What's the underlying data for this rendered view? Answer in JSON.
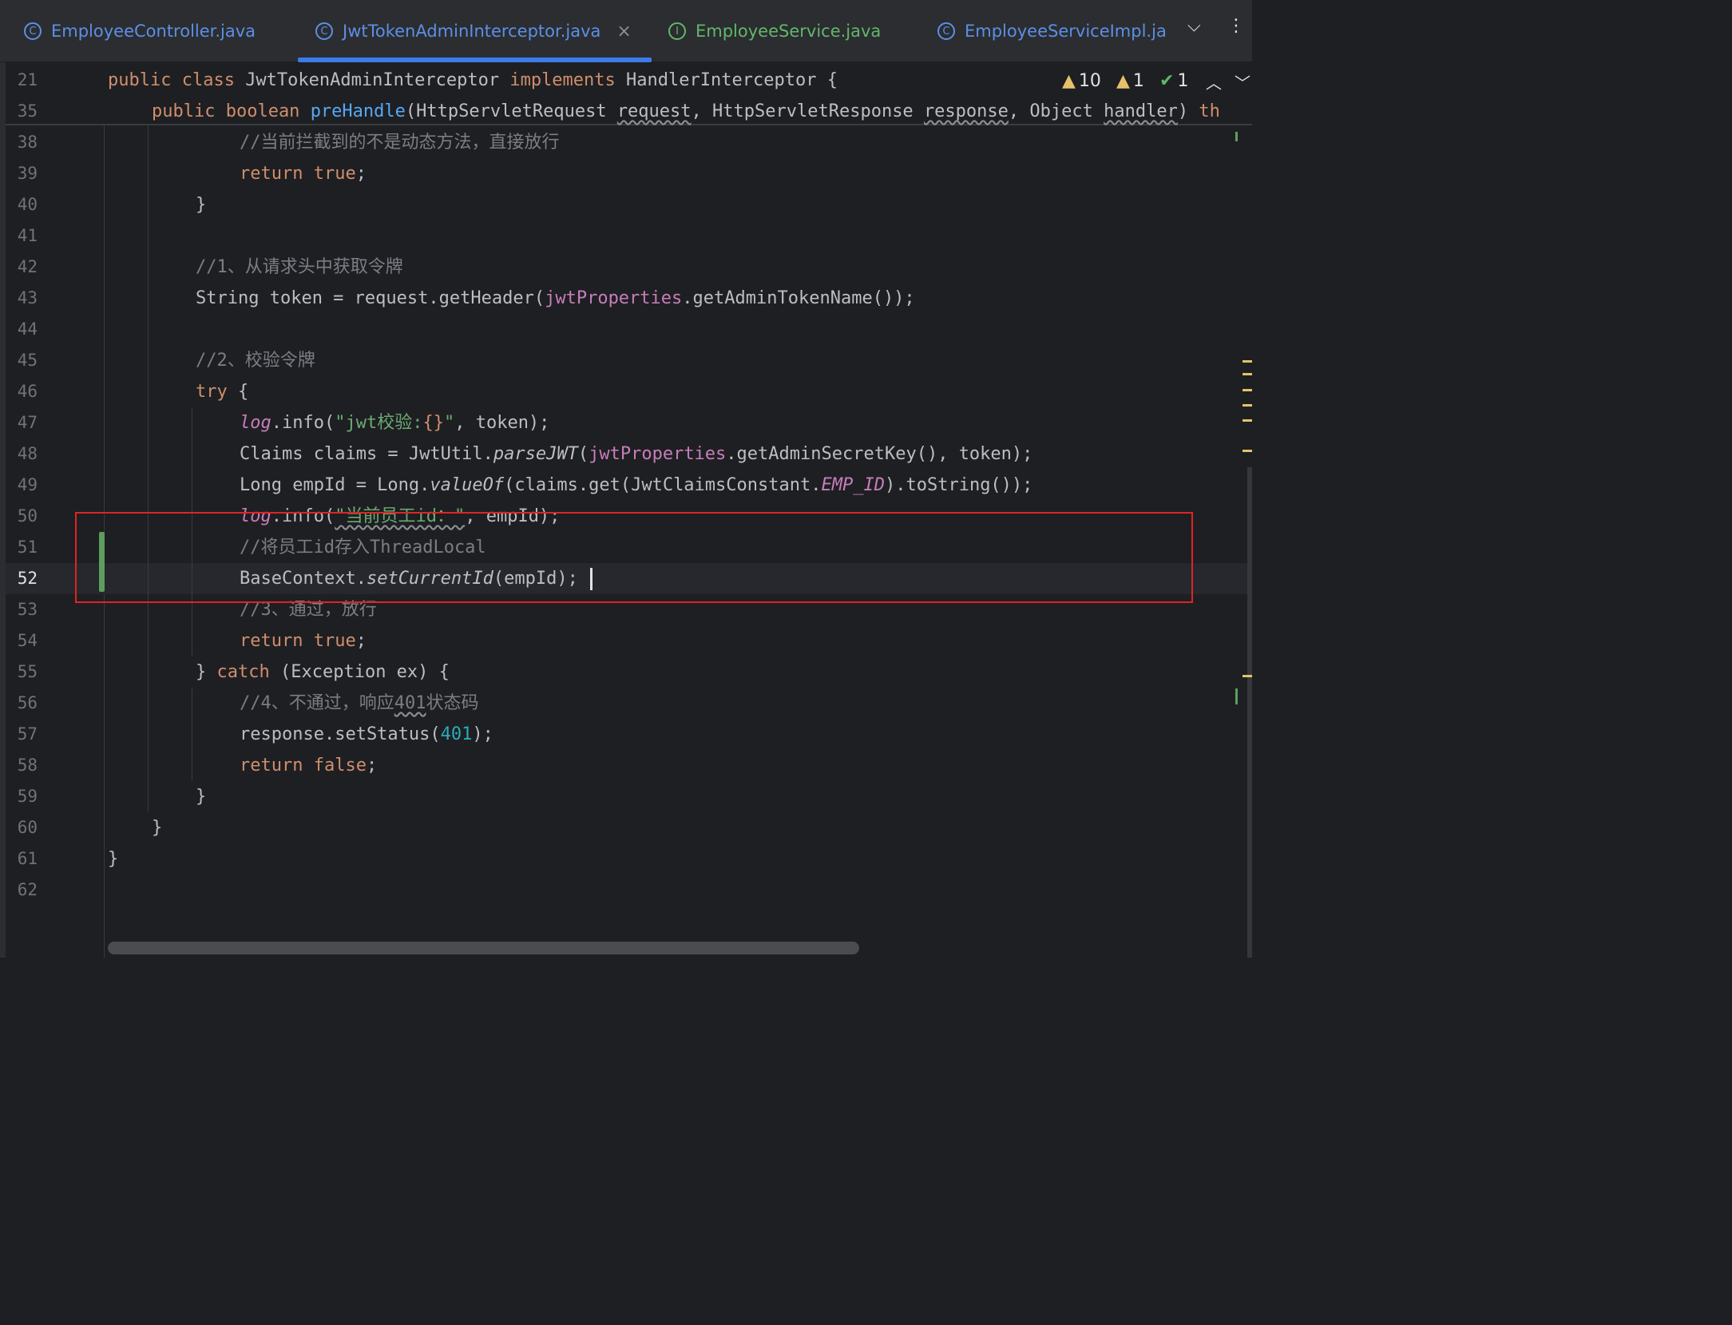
{
  "tabs": [
    {
      "label": "EmployeeController.java",
      "icon": "class-icon",
      "glyph": "C"
    },
    {
      "label": "JwtTokenAdminInterceptor.java",
      "icon": "class-icon",
      "glyph": "C",
      "active": true,
      "close": "×"
    },
    {
      "label": "EmployeeService.java",
      "icon": "interface-icon",
      "glyph": "I"
    },
    {
      "label": "EmployeeServiceImpl.ja",
      "icon": "class-icon",
      "glyph": "C"
    }
  ],
  "tab_menu": {
    "dropdown": "⌵",
    "more": "⋮"
  },
  "inspections": {
    "warnings": "10",
    "weak_warnings": "1",
    "typos": "1",
    "up": "︿",
    "down": "﹀"
  },
  "sticky": [
    {
      "num": "21",
      "tokens": [
        {
          "t": "public class ",
          "c": "kw"
        },
        {
          "t": "JwtTokenAdminInterceptor "
        },
        {
          "t": "implements ",
          "c": "kw"
        },
        {
          "t": "HandlerInterceptor {"
        }
      ]
    },
    {
      "num": "35",
      "tokens": [
        {
          "t": "public boolean ",
          "c": "kw"
        },
        {
          "t": "preHandle",
          "c": "fn"
        },
        {
          "t": "(HttpServletRequest "
        },
        {
          "t": "request",
          "c": "wavy"
        },
        {
          "t": ", HttpServletResponse "
        },
        {
          "t": "response",
          "c": "wavy"
        },
        {
          "t": ", Object "
        },
        {
          "t": "handler",
          "c": "wavy"
        },
        {
          "t": ") "
        },
        {
          "t": "th",
          "c": "kw"
        }
      ]
    }
  ],
  "lines": [
    {
      "num": "38",
      "tokens": [
        {
          "t": "//当前拦截到的不是动态方法，直接放行",
          "c": "cm"
        }
      ]
    },
    {
      "num": "39",
      "tokens": [
        {
          "t": "return true",
          "c": "kw"
        },
        {
          "t": ";"
        }
      ]
    },
    {
      "num": "40",
      "tokens": [
        {
          "t": "}"
        }
      ]
    },
    {
      "num": "41",
      "tokens": []
    },
    {
      "num": "42",
      "tokens": [
        {
          "t": "//1、从请求头中获取令牌",
          "c": "cm"
        }
      ]
    },
    {
      "num": "43",
      "tokens": [
        {
          "t": "String token = request.getHeader("
        },
        {
          "t": "jwtProperties",
          "c": "fld"
        },
        {
          "t": ".getAdminTokenName());"
        }
      ]
    },
    {
      "num": "44",
      "tokens": []
    },
    {
      "num": "45",
      "tokens": [
        {
          "t": "//2、校验令牌",
          "c": "cm"
        }
      ]
    },
    {
      "num": "46",
      "tokens": [
        {
          "t": "try ",
          "c": "kw"
        },
        {
          "t": "{"
        }
      ]
    },
    {
      "num": "47",
      "tokens": [
        {
          "t": "log",
          "c": "fld it"
        },
        {
          "t": ".info("
        },
        {
          "t": "\"jwt校验:",
          "c": "st"
        },
        {
          "t": "{}",
          "c": "kw"
        },
        {
          "t": "\"",
          "c": "st"
        },
        {
          "t": ", token);"
        }
      ]
    },
    {
      "num": "48",
      "tokens": [
        {
          "t": "Claims claims = JwtUtil."
        },
        {
          "t": "parseJWT",
          "c": "it"
        },
        {
          "t": "("
        },
        {
          "t": "jwtProperties",
          "c": "fld"
        },
        {
          "t": ".getAdminSecretKey(), token);"
        }
      ]
    },
    {
      "num": "49",
      "tokens": [
        {
          "t": "Long empId = Long."
        },
        {
          "t": "valueOf",
          "c": "it"
        },
        {
          "t": "(claims.get(JwtClaimsConstant."
        },
        {
          "t": "EMP_ID",
          "c": "cst"
        },
        {
          "t": ").toString());"
        }
      ]
    },
    {
      "num": "50",
      "tokens": [
        {
          "t": "log",
          "c": "fld it"
        },
        {
          "t": ".info("
        },
        {
          "t": "\"当前员工id：\"",
          "c": "st wavy"
        },
        {
          "t": ", empId);"
        }
      ]
    },
    {
      "num": "51",
      "tokens": [
        {
          "t": "//将员工id存入ThreadLocal",
          "c": "cm"
        }
      ]
    },
    {
      "num": "52",
      "tokens": [
        {
          "t": "BaseContext."
        },
        {
          "t": "setCurrentId",
          "c": "it"
        },
        {
          "t": "(empId);"
        }
      ]
    },
    {
      "num": "53",
      "tokens": [
        {
          "t": "//3、通过，放行",
          "c": "cm"
        }
      ]
    },
    {
      "num": "54",
      "tokens": [
        {
          "t": "return true",
          "c": "kw"
        },
        {
          "t": ";"
        }
      ]
    },
    {
      "num": "55",
      "tokens": [
        {
          "t": "} "
        },
        {
          "t": "catch ",
          "c": "kw"
        },
        {
          "t": "(Exception ex) {"
        }
      ]
    },
    {
      "num": "56",
      "tokens": [
        {
          "t": "//4、不通过，响应",
          "c": "cm"
        },
        {
          "t": "401",
          "c": "cm wavy"
        },
        {
          "t": "状态码",
          "c": "cm"
        }
      ]
    },
    {
      "num": "57",
      "tokens": [
        {
          "t": "response.setStatus("
        },
        {
          "t": "401",
          "c": "num"
        },
        {
          "t": ");"
        }
      ]
    },
    {
      "num": "58",
      "tokens": [
        {
          "t": "return false",
          "c": "kw"
        },
        {
          "t": ";"
        }
      ]
    },
    {
      "num": "59",
      "tokens": [
        {
          "t": "}"
        }
      ]
    },
    {
      "num": "60",
      "tokens": [
        {
          "t": "}"
        }
      ]
    },
    {
      "num": "61",
      "tokens": [
        {
          "t": "}"
        }
      ]
    },
    {
      "num": "62",
      "tokens": []
    }
  ],
  "current_line": "52",
  "highlight_color": "#e02424"
}
